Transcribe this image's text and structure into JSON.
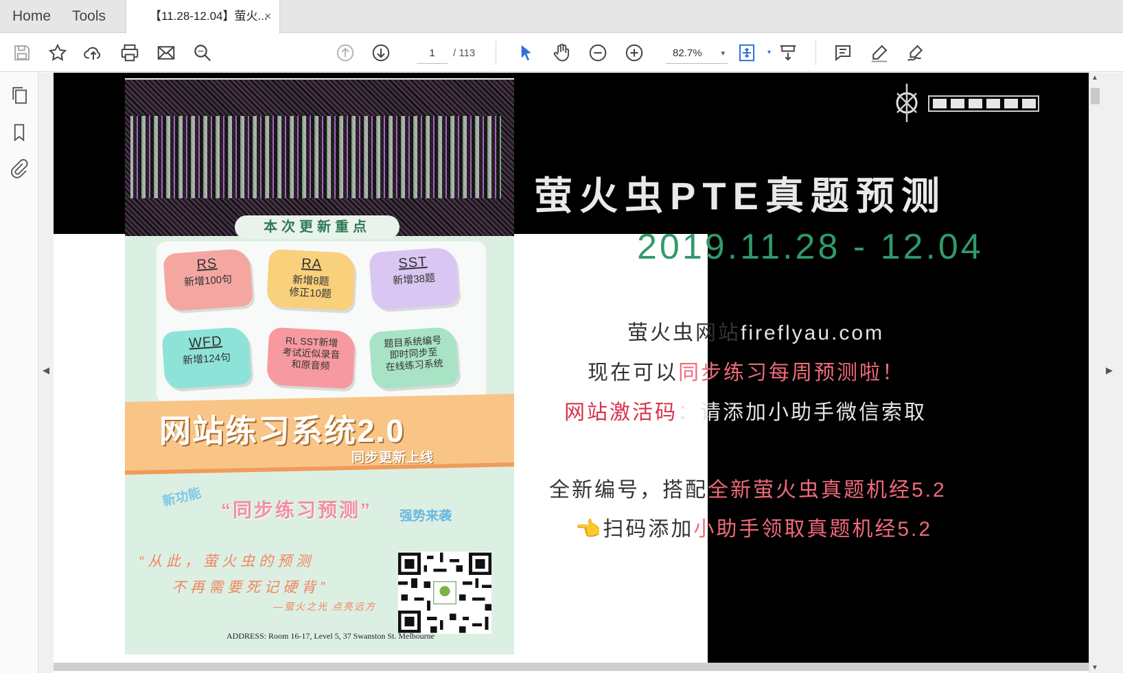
{
  "tabs": {
    "home": "Home",
    "tools": "Tools",
    "document": "【11.28-12.04】萤火...",
    "close": "×"
  },
  "toolbar": {
    "current_page": "1",
    "total_pages": "/ 113",
    "zoom": "82.7%",
    "zoom_caret": "▾",
    "fit_caret": "▾"
  },
  "nav": {
    "left_arrow": "◀",
    "right_arrow": "▶",
    "scroll_up": "▲",
    "scroll_down": "▼"
  },
  "poster": {
    "header_pill": "本次更新重点",
    "cards": [
      {
        "title": "RS",
        "lines": [
          "新增100句"
        ]
      },
      {
        "title": "RA",
        "lines": [
          "新增8题",
          "修正10题"
        ]
      },
      {
        "title": "SST",
        "lines": [
          "新增38题"
        ]
      },
      {
        "title": "WFD",
        "lines": [
          "新增124句"
        ]
      },
      {
        "title": "",
        "lines": [
          "RL SST新增",
          "考试近似录音",
          "和原音频"
        ]
      },
      {
        "title": "",
        "lines": [
          "题目系统编号",
          "即时同步至",
          "在线练习系统"
        ]
      }
    ],
    "band_title": "网站练习系统2.0",
    "band_subtitle": "同步更新上线",
    "new_feature": "新功能",
    "sync_practice": "“同步练习预测”",
    "strong_coming": "强势来袭",
    "quote_line1": "“从此，萤火虫的预测",
    "quote_line2": "不再需要死记硬背”",
    "quote_sign": "—萤火之光 点亮远方",
    "address": "ADDRESS: Room 16-17, Level 5, 37 Swanston St. Melbourne"
  },
  "right": {
    "title": "萤火虫PTE真题预测",
    "date": "2019.11.28 - 12.04",
    "line1_a": "萤火虫网站",
    "line1_b": "fireflyau.com",
    "line2_a": "现在可以",
    "line2_b": "同步练习每周预测啦！",
    "line3_a": "网站激活码",
    "line3_b": "：请添加小助手微信索取",
    "line4_a": "全新编号，搭配",
    "line4_b": "全新萤火虫真题机经5.2",
    "line5_a": "扫码添加",
    "line5_b": "小助手领取真题机经5.2",
    "hand": "👈"
  },
  "icons": {
    "save": "save-icon",
    "star": "star-icon",
    "upload": "cloud-upload-icon",
    "print": "printer-icon",
    "mail": "mail-icon",
    "search": "search-icon",
    "prev": "page-up-icon",
    "next": "page-down-icon",
    "select": "cursor-arrow-icon",
    "hand": "hand-icon",
    "zoom_out": "zoom-out-icon",
    "zoom_in": "zoom-in-icon",
    "fit": "fit-page-icon",
    "scroll_mode": "scroll-mode-icon",
    "comment": "comment-icon",
    "highlight": "pen-icon",
    "sign": "sign-icon"
  },
  "colors": {
    "accent_blue": "#2f6fd6",
    "title_green": "#2f9a6a",
    "activation_red": "#d8324a"
  }
}
